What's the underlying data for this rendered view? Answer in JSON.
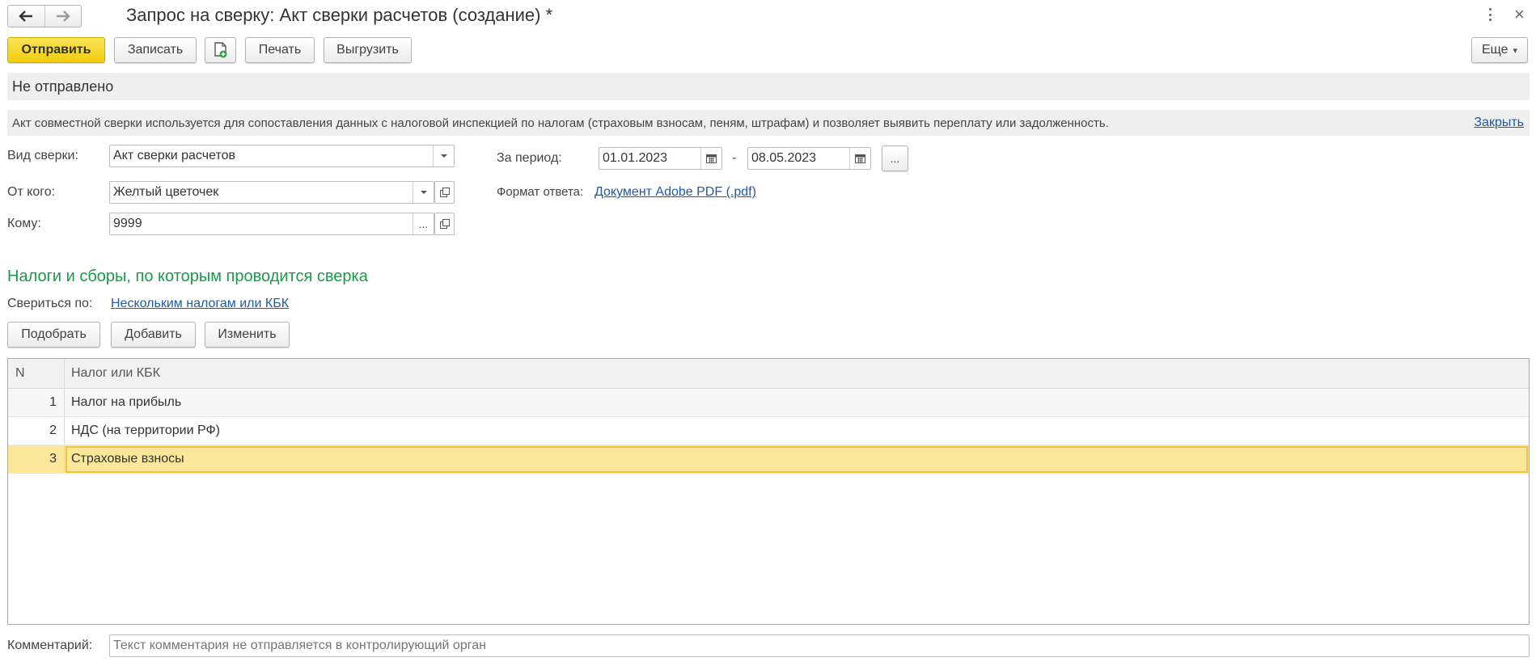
{
  "header": {
    "title": "Запрос на сверку: Акт сверки расчетов (создание) *",
    "back_icon": "arrow-left-icon",
    "forward_icon": "arrow-right-icon",
    "more_icon": "vertical-dots-icon",
    "close_symbol": "×"
  },
  "toolbar": {
    "send_label": "Отправить",
    "save_label": "Записать",
    "print_label": "Печать",
    "export_label": "Выгрузить",
    "more_label": "Еще",
    "more_arrow": "▾"
  },
  "status": {
    "text": "Не отправлено"
  },
  "info": {
    "text": "Акт совместной сверки используется для сопоставления данных с налоговой инспекцией по налогам (страховым взносам, пеням, штрафам) и позволяет выявить переплату или задолженность.",
    "close_label": "Закрыть"
  },
  "form": {
    "kind_label": "Вид сверки:",
    "kind_value": "Акт сверки расчетов",
    "from_label": "От кого:",
    "from_value": "Желтый цветочек",
    "to_label": "Кому:",
    "to_value": "9999",
    "period_label": "За период:",
    "period_from": "01.01.2023",
    "period_dash": "-",
    "period_to": "08.05.2023",
    "format_label": "Формат ответа:",
    "format_value": "Документ Adobe PDF (.pdf)",
    "ellipsis": "..."
  },
  "taxes": {
    "section_title": "Налоги и сборы, по которым проводится сверка",
    "reconcile_label": "Свериться по:",
    "reconcile_value": "Нескольким налогам или КБК",
    "pick_label": "Подобрать",
    "add_label": "Добавить",
    "edit_label": "Изменить",
    "columns": [
      "N",
      "Налог или КБК"
    ],
    "rows": [
      {
        "n": "1",
        "name": "Налог на прибыль"
      },
      {
        "n": "2",
        "name": "НДС (на территории РФ)"
      },
      {
        "n": "3",
        "name": "Страховые взносы"
      }
    ],
    "selected_row": 3
  },
  "comment": {
    "label": "Комментарий:",
    "placeholder": "Текст комментария не отправляется в контролирующий орган"
  },
  "colors": {
    "accent_yellow": "#f2cd0c",
    "section_green": "#1a9a4a",
    "link_blue": "#1e5aa5",
    "selected_row": "#fde79a"
  }
}
